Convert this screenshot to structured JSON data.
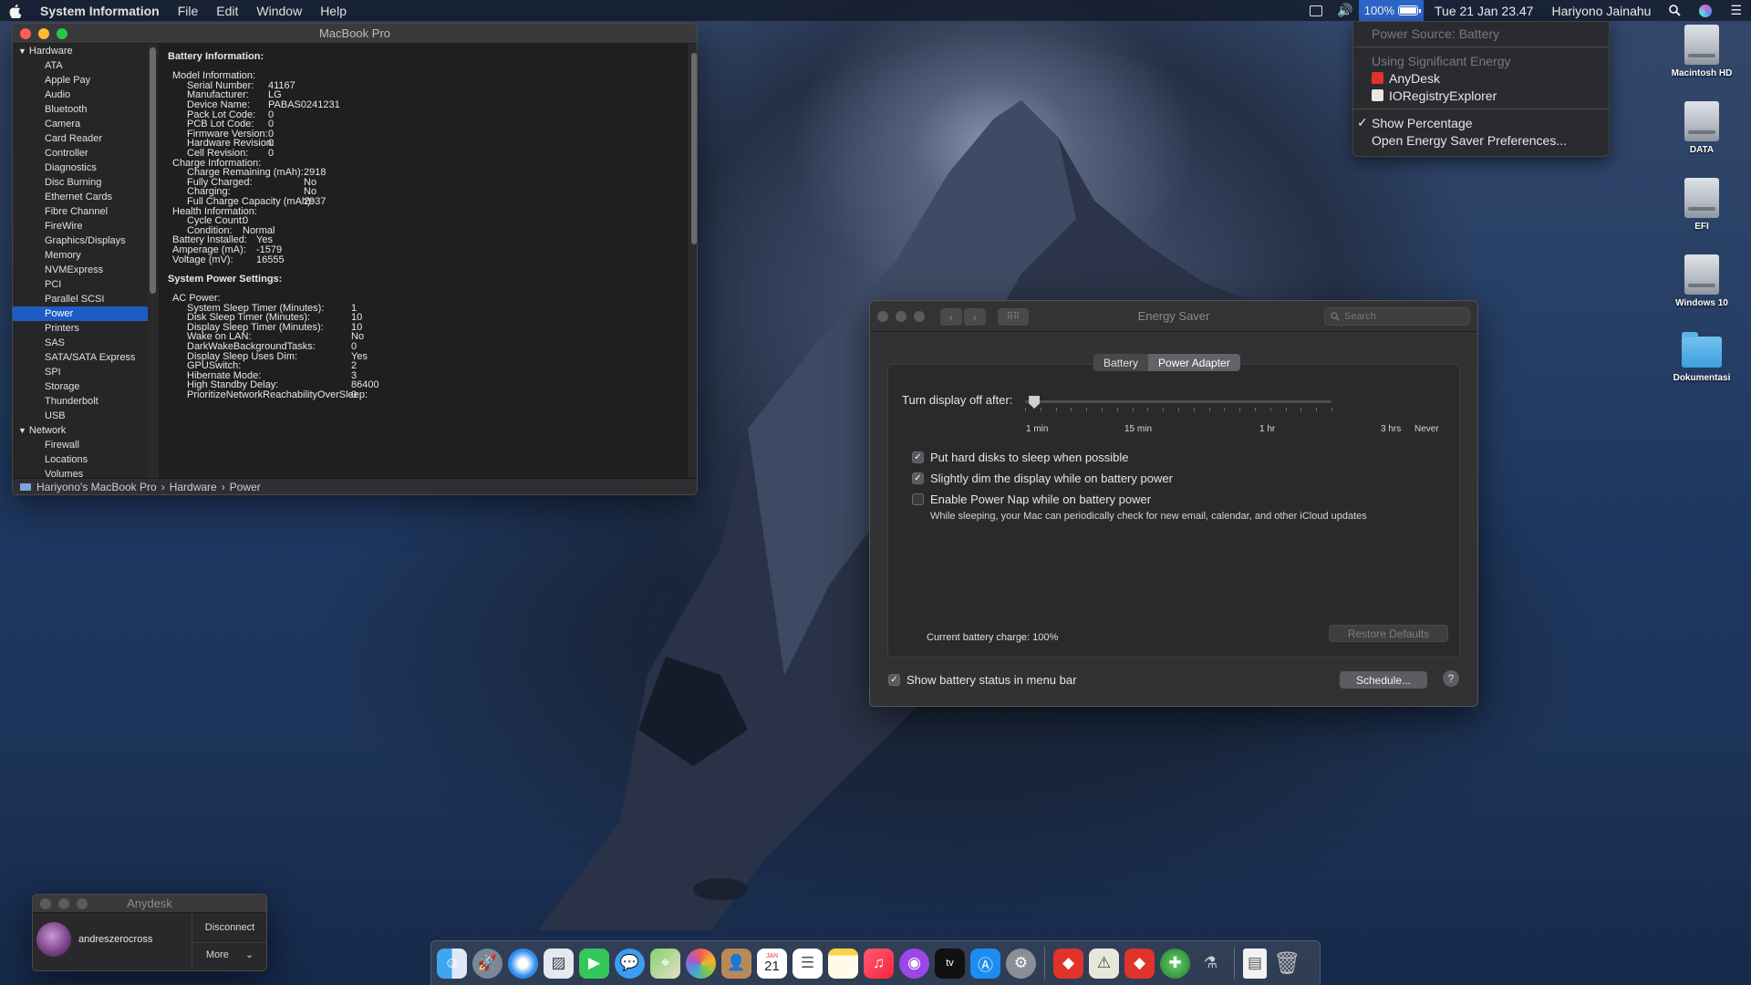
{
  "menubar": {
    "app": "System Information",
    "menus": [
      "File",
      "Edit",
      "Window",
      "Help"
    ],
    "battery_pct": "100%",
    "datetime": "Tue 21 Jan  23.47",
    "user": "Hariyono Jainahu"
  },
  "battery_menu": {
    "source": "Power Source: Battery",
    "sig_header": "Using Significant Energy",
    "apps": [
      "AnyDesk",
      "IORegistryExplorer"
    ],
    "show_pct": "Show Percentage",
    "open_prefs": "Open Energy Saver Preferences..."
  },
  "desktop": {
    "icons": [
      "Macintosh HD",
      "DATA",
      "EFI",
      "Windows 10",
      "Dokumentasi"
    ]
  },
  "sysinfo": {
    "title": "MacBook Pro",
    "hardware_label": "Hardware",
    "hardware": [
      "ATA",
      "Apple Pay",
      "Audio",
      "Bluetooth",
      "Camera",
      "Card Reader",
      "Controller",
      "Diagnostics",
      "Disc Burning",
      "Ethernet Cards",
      "Fibre Channel",
      "FireWire",
      "Graphics/Displays",
      "Memory",
      "NVMExpress",
      "PCI",
      "Parallel SCSI",
      "Power",
      "Printers",
      "SAS",
      "SATA/SATA Express",
      "SPI",
      "Storage",
      "Thunderbolt",
      "USB"
    ],
    "network_label": "Network",
    "network": [
      "Firewall",
      "Locations",
      "Volumes"
    ],
    "section1": "Battery Information:",
    "section2": "System Power Settings:",
    "model_info": "Model Information:",
    "model": [
      [
        "Serial Number:",
        "41167"
      ],
      [
        "Manufacturer:",
        "LG"
      ],
      [
        "Device Name:",
        "PABAS0241231"
      ],
      [
        "Pack Lot Code:",
        "0"
      ],
      [
        "PCB Lot Code:",
        "0"
      ],
      [
        "Firmware Version:",
        "0"
      ],
      [
        "Hardware Revision:",
        "0"
      ],
      [
        "Cell Revision:",
        "0"
      ]
    ],
    "charge_info": "Charge Information:",
    "charge": [
      [
        "Charge Remaining (mAh):",
        "2918"
      ],
      [
        "Fully Charged:",
        "No"
      ],
      [
        "Charging:",
        "No"
      ],
      [
        "Full Charge Capacity (mAh):",
        "2937"
      ]
    ],
    "health_info": "Health Information:",
    "health": [
      [
        "Cycle Count:",
        "0"
      ],
      [
        "Condition:",
        "Normal"
      ]
    ],
    "misc": [
      [
        "Battery Installed:",
        "Yes"
      ],
      [
        "Amperage (mA):",
        "-1579"
      ],
      [
        "Voltage (mV):",
        "16555"
      ]
    ],
    "ac_power": "AC Power:",
    "ac": [
      [
        "System Sleep Timer (Minutes):",
        "1"
      ],
      [
        "Disk Sleep Timer (Minutes):",
        "10"
      ],
      [
        "Display Sleep Timer (Minutes):",
        "10"
      ],
      [
        "Wake on LAN:",
        "No"
      ],
      [
        "DarkWakeBackgroundTasks:",
        "0"
      ],
      [
        "Display Sleep Uses Dim:",
        "Yes"
      ],
      [
        "GPUSwitch:",
        "2"
      ],
      [
        "Hibernate Mode:",
        "3"
      ],
      [
        "High Standby Delay:",
        "86400"
      ],
      [
        "PrioritizeNetworkReachabilityOverSleep:",
        "0"
      ]
    ],
    "path": [
      "Hariyono's MacBook Pro",
      "Hardware",
      "Power"
    ]
  },
  "energy": {
    "title": "Energy Saver",
    "search_placeholder": "Search",
    "tabs": [
      "Battery",
      "Power Adapter"
    ],
    "slider_label": "Turn display off after:",
    "slider_ticks": [
      "1 min",
      "15 min",
      "1 hr",
      "3 hrs",
      "Never"
    ],
    "slider_value_fraction": 0.03,
    "options": [
      {
        "label": "Put hard disks to sleep when possible",
        "checked": true
      },
      {
        "label": "Slightly dim the display while on battery power",
        "checked": true
      },
      {
        "label": "Enable Power Nap while on battery power",
        "checked": false
      }
    ],
    "powernap_desc": "While sleeping, your Mac can periodically check for new email, calendar, and other iCloud updates",
    "charge_text": "Current battery charge: 100%",
    "restore": "Restore Defaults",
    "show_status": "Show battery status in menu bar",
    "schedule": "Schedule...",
    "help": "?"
  },
  "anydesk": {
    "title": "Anydesk",
    "user": "andreszerocross",
    "disconnect": "Disconnect",
    "more": "More"
  },
  "dock": {
    "calendar_day": "21",
    "calendar_month": "JAN",
    "tv": "tv"
  }
}
